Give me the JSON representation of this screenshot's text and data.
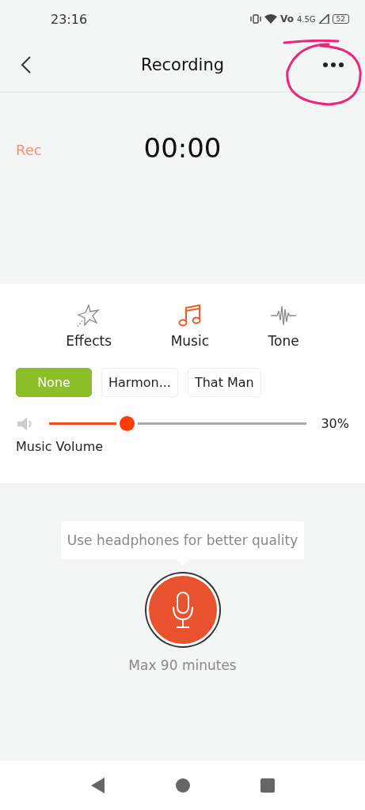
{
  "status_bar": {
    "time": "23:16",
    "volte": "Vo",
    "network": "4.5G",
    "battery": "52"
  },
  "header": {
    "title": "Recording",
    "annotation": true
  },
  "recorder": {
    "label": "Rec",
    "timer": "00:00"
  },
  "tabs": [
    {
      "label": "Effects",
      "kind": "effects",
      "selected": false
    },
    {
      "label": "Music",
      "kind": "music",
      "selected": true
    },
    {
      "label": "Tone",
      "kind": "tone",
      "selected": false
    }
  ],
  "tracks": [
    {
      "label": "None",
      "selected": true
    },
    {
      "label": "Harmon...",
      "selected": false
    },
    {
      "label": "That Man",
      "selected": false
    }
  ],
  "volume": {
    "level": 0.3,
    "reading": "30%",
    "label": "Music Volume"
  },
  "tip": "Use headphones for better quality",
  "limit": "Max 90 minutes"
}
